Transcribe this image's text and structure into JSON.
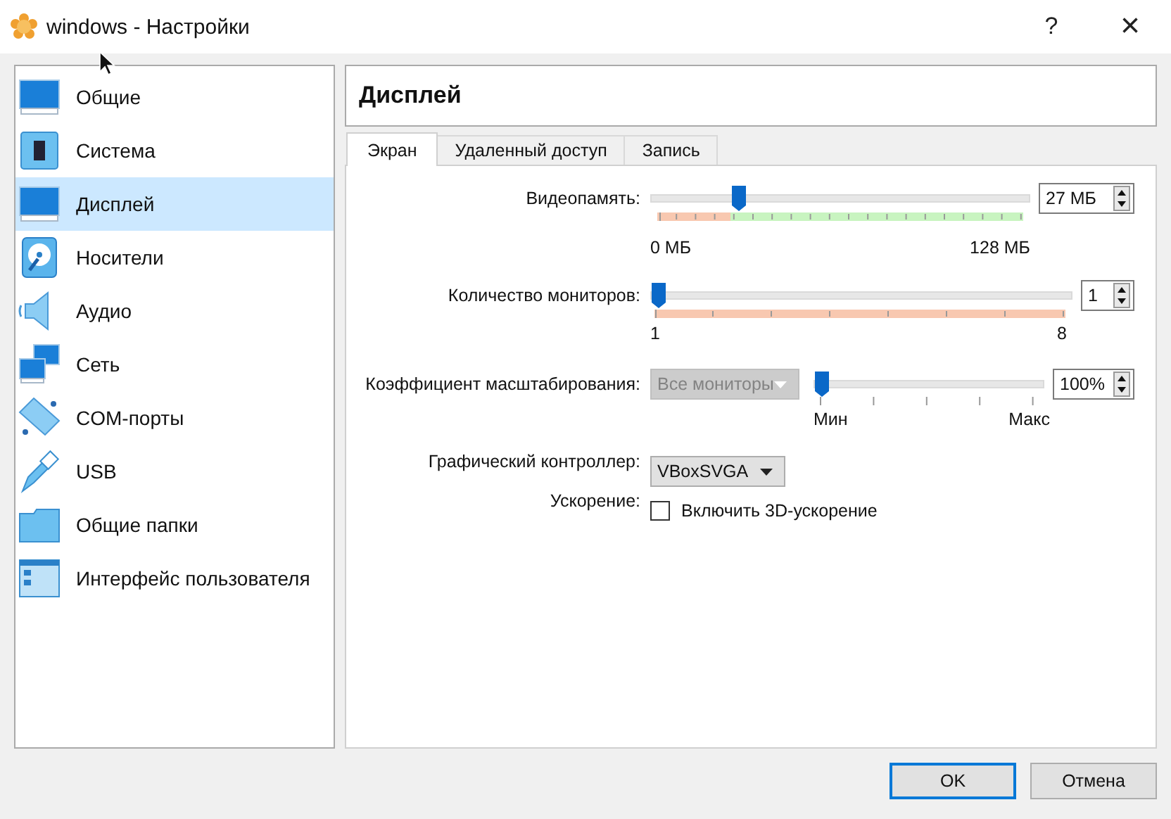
{
  "window": {
    "title": "windows - Настройки",
    "help": "?",
    "close": "×"
  },
  "sidebar": {
    "items": [
      {
        "label": "Общие",
        "selected": false
      },
      {
        "label": "Система",
        "selected": false
      },
      {
        "label": "Дисплей",
        "selected": true
      },
      {
        "label": "Носители",
        "selected": false
      },
      {
        "label": "Аудио",
        "selected": false
      },
      {
        "label": "Сеть",
        "selected": false
      },
      {
        "label": "COM-порты",
        "selected": false
      },
      {
        "label": "USB",
        "selected": false
      },
      {
        "label": "Общие папки",
        "selected": false
      },
      {
        "label": "Интерфейс пользователя",
        "selected": false
      }
    ]
  },
  "page": {
    "title": "Дисплей"
  },
  "tabs": [
    {
      "label": "Экран",
      "selected": true
    },
    {
      "label": "Удаленный доступ",
      "selected": false
    },
    {
      "label": "Запись",
      "selected": false
    }
  ],
  "video_memory": {
    "label": "Видеопамять:",
    "level": 0.22,
    "value": "27 МБ",
    "min_label": "0 МБ",
    "max_label": "128 МБ"
  },
  "monitors": {
    "label": "Количество мониторов:",
    "level": 0,
    "value": "1",
    "min_label": "1",
    "max_label": "8"
  },
  "scale": {
    "label": "Коэффициент масштабирования:",
    "dropdown": {
      "value": "Все мониторы",
      "disabled": true
    },
    "level": 0,
    "value": "100%",
    "min_label": "Мин",
    "max_label": "Макс"
  },
  "controller": {
    "label": "Графический контроллер:",
    "value": "VBoxSVGA"
  },
  "acceleration": {
    "label": "Ускорение:",
    "checkbox_label": "Включить 3D-ускорение",
    "checked": false
  },
  "buttons": [
    {
      "label": "OK",
      "default": true
    },
    {
      "label": "Отмена",
      "default": false
    }
  ]
}
